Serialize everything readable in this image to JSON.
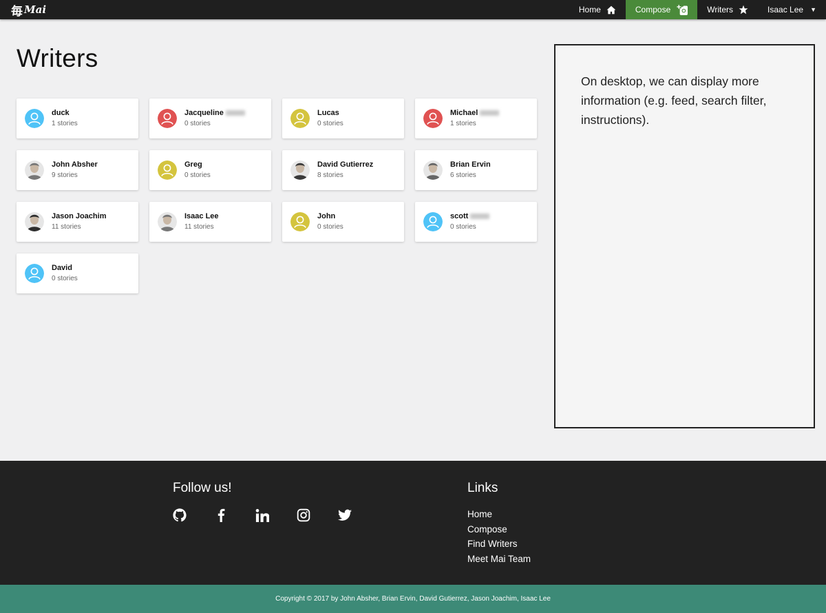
{
  "nav": {
    "logo_kanji": "毎",
    "logo_word": "Mai",
    "items": [
      {
        "label": "Home",
        "icon": "home-icon"
      },
      {
        "label": "Compose",
        "icon": "add-photo-icon"
      },
      {
        "label": "Writers",
        "icon": "star-icon"
      }
    ],
    "user": "Isaac Lee",
    "user_caret": "▼",
    "active_color": "#4a8a3a"
  },
  "main": {
    "title": "Writers",
    "writers": [
      {
        "name": "duck",
        "stories": "1 stories",
        "avatar": "default",
        "color": "#4fc3f7"
      },
      {
        "name": "Jacqueline",
        "stories": "0 stories",
        "avatar": "default",
        "color": "#e05252",
        "blurred": true
      },
      {
        "name": "Lucas",
        "stories": "0 stories",
        "avatar": "default",
        "color": "#d4c43e"
      },
      {
        "name": "Michael",
        "stories": "1 stories",
        "avatar": "default",
        "color": "#e05252",
        "blurred": true
      },
      {
        "name": "John Absher",
        "stories": "9 stories",
        "avatar": "photo"
      },
      {
        "name": "Greg",
        "stories": "0 stories",
        "avatar": "default",
        "color": "#d4c43e"
      },
      {
        "name": "David Gutierrez",
        "stories": "8 stories",
        "avatar": "photo"
      },
      {
        "name": "Brian Ervin",
        "stories": "6 stories",
        "avatar": "photo"
      },
      {
        "name": "Jason Joachim",
        "stories": "11 stories",
        "avatar": "photo"
      },
      {
        "name": "Isaac Lee",
        "stories": "11 stories",
        "avatar": "photo"
      },
      {
        "name": "John",
        "stories": "0 stories",
        "avatar": "default",
        "color": "#d4c43e"
      },
      {
        "name": "scott",
        "stories": "0 stories",
        "avatar": "default",
        "color": "#4fc3f7",
        "blurred": true
      },
      {
        "name": "David",
        "stories": "0 stories",
        "avatar": "default",
        "color": "#4fc3f7"
      }
    ]
  },
  "side_panel": {
    "text": "On desktop, we can display more information (e.g. feed, search filter, instructions)."
  },
  "footer": {
    "follow_title": "Follow us!",
    "social": [
      "github-icon",
      "facebook-icon",
      "linkedin-icon",
      "instagram-icon",
      "twitter-icon"
    ],
    "links_title": "Links",
    "links": [
      "Home",
      "Compose",
      "Find Writers",
      "Meet Mai Team"
    ],
    "copyright": "Copyright © 2017 by John Absher, Brian Ervin, David Gutierrez, Jason Joachim, Isaac Lee",
    "copyright_bg": "#3d8a77"
  }
}
